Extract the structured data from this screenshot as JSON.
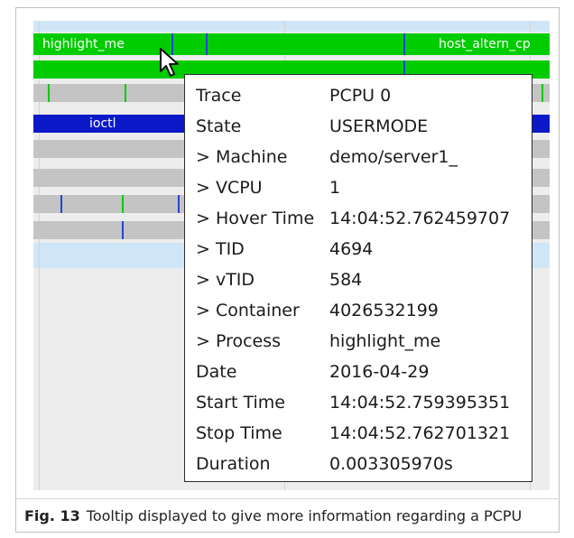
{
  "screen": {
    "timeline": {
      "rows": [
        {
          "label": "highlight_me",
          "secondary_label": "host_altern_cp",
          "state": "green"
        },
        {
          "state": "green"
        },
        {
          "state": "gray"
        },
        {
          "label": "ioctl",
          "state": "blue"
        },
        {
          "state": "gray"
        },
        {
          "state": "gray"
        },
        {
          "state": "gray"
        },
        {
          "state": "gray"
        }
      ]
    },
    "tooltip": {
      "rows": [
        {
          "key": "Trace",
          "value": "PCPU 0"
        },
        {
          "key": "State",
          "value": "USERMODE"
        },
        {
          "key": "> Machine",
          "value": "demo/server1_"
        },
        {
          "key": "> VCPU",
          "value": "1"
        },
        {
          "key": "> Hover Time",
          "value": "14:04:52.762459707"
        },
        {
          "key": "> TID",
          "value": "4694"
        },
        {
          "key": "> vTID",
          "value": "584"
        },
        {
          "key": "> Container",
          "value": "4026532199"
        },
        {
          "key": "> Process",
          "value": "highlight_me"
        },
        {
          "key": "Date",
          "value": "2016-04-29"
        },
        {
          "key": "Start Time",
          "value": "14:04:52.759395351"
        },
        {
          "key": "Stop Time",
          "value": "14:04:52.762701321"
        },
        {
          "key": "Duration",
          "value": "0.003305970s"
        }
      ]
    }
  },
  "caption": {
    "label": "Fig. 13",
    "text": "Tooltip displayed to give more information regarding a PCPU"
  },
  "colors": {
    "green": "#00cc00",
    "gray": "#c4c4c4",
    "blue": "#0b19c8",
    "light_blue": "#cfe6f7"
  }
}
